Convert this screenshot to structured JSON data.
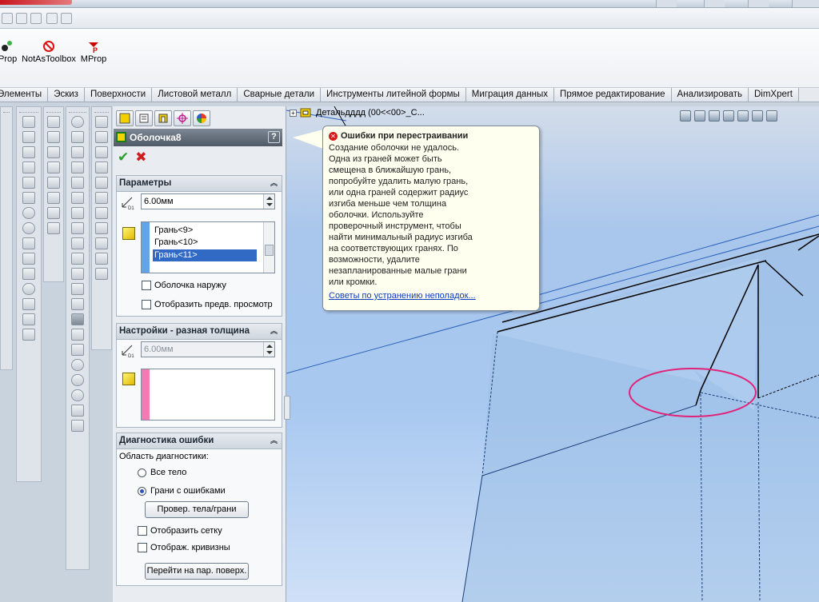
{
  "toolbar_tools": [
    {
      "label": "Prop",
      "icon": "prop-icon"
    },
    {
      "label": "NotAsToolbox",
      "icon": "no-sign-icon"
    },
    {
      "label": "MProp",
      "icon": "mprop-icon"
    }
  ],
  "tabs": [
    "Элементы",
    "Эскиз",
    "Поверхности",
    "Листовой металл",
    "Сварные детали",
    "Инструменты литейной формы",
    "Миграция данных",
    "Прямое редактирование",
    "Анализировать",
    "DimXpert"
  ],
  "property_manager": {
    "title": "Оболочка8",
    "help_label": "?",
    "parameters": {
      "header": "Параметры",
      "thickness": "6.00мм",
      "faces": [
        "Грань<9>",
        "Грань<10>",
        "Грань<11>"
      ],
      "selected_face_index": 2,
      "shell_outward": "Оболочка наружу",
      "show_preview": "Отобразить предв. просмотр"
    },
    "multi_thickness": {
      "header": "Настройки - разная толщина",
      "thickness": "6.00мм"
    },
    "diagnostics": {
      "header": "Диагностика ошибки",
      "scope_label": "Область диагностики:",
      "whole_body": "Все тело",
      "faces_with_errors": "Грани с ошибками",
      "check_button": "Провер. тела/грани",
      "show_mesh": "Отобразить сетку",
      "show_curvature": "Отображ. кривизны",
      "goto_button": "Перейти на пар. поверх."
    }
  },
  "tree_label": "Детальдддд (00<<00>_С...",
  "error_balloon": {
    "title": "Ошибки при перестраивании",
    "body": "Создание оболочки не удалось.\nОдна из граней может быть\nсмещена в ближайшую грань,\nпопробуйте удалить малую грань,\nили одна граней содержит радиус\nизгиба меньше чем толщина\nоболочки. Используйте\nпроверочный инструмент, чтобы\nнайти минимальный радиус изгиба\nна соответствующих гранях. По\nвозможности, удалите\nнезапланированные малые грани\nили кромки.",
    "link": "Советы по устранению неполадок..."
  },
  "colors": {
    "accent_pink": "#e0247a",
    "selection_blue": "#316ac5",
    "error_red": "#d41c1c"
  }
}
